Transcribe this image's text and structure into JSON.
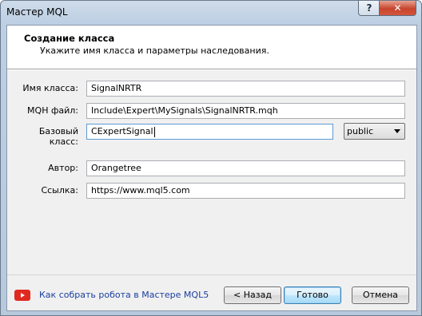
{
  "window": {
    "title": "Мастер MQL",
    "help_label": "?",
    "close_label": "✕"
  },
  "header": {
    "title": "Создание класса",
    "subtitle": "Укажите имя класса и параметры наследования."
  },
  "form": {
    "class_name": {
      "label": "Имя класса:",
      "value": "SignalNRTR"
    },
    "mqh_file": {
      "label": "MQH файл:",
      "value": "Include\\Expert\\MySignals\\SignalNRTR.mqh"
    },
    "base_class": {
      "label": "Базовый класс:",
      "value": "CExpertSignal"
    },
    "access": {
      "selected": "public"
    },
    "author": {
      "label": "Автор:",
      "value": "Orangetree"
    },
    "link": {
      "label": "Ссылка:",
      "value": "https://www.mql5.com"
    }
  },
  "footer": {
    "video_link": "Как собрать робота в Мастере MQL5",
    "back_label": "< Назад",
    "done_label": "Готово",
    "cancel_label": "Отмена"
  },
  "colors": {
    "link": "#1a3fa0",
    "youtube": "#e02a20",
    "close": "#c7452d"
  }
}
